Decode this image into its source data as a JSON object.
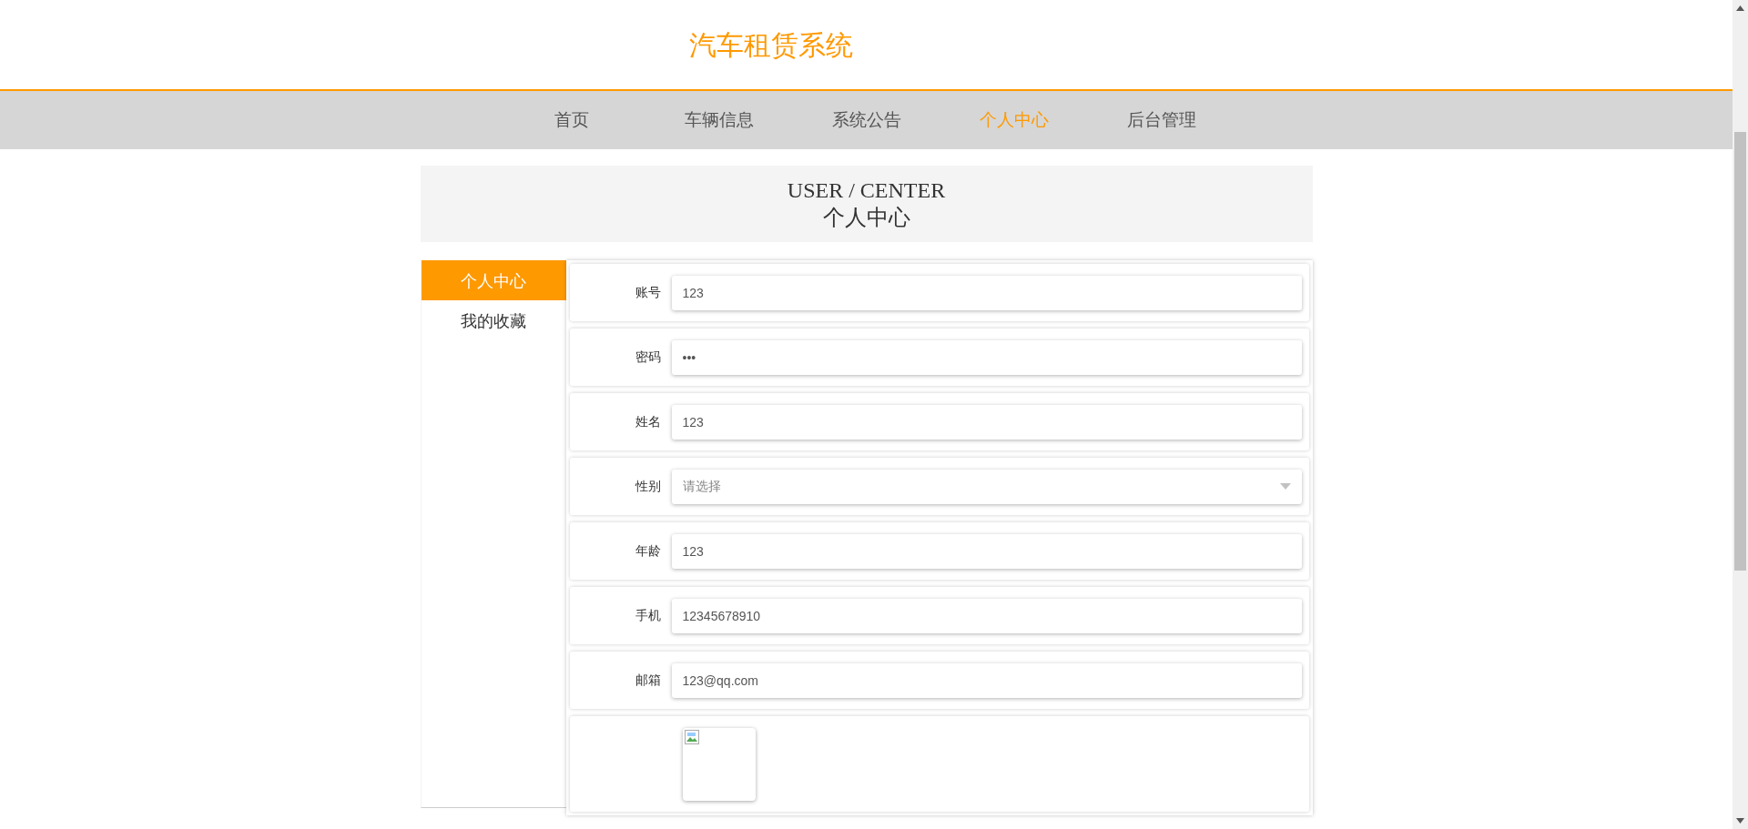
{
  "header": {
    "title": "汽车租赁系统"
  },
  "nav": [
    {
      "label": "首页",
      "selected": false
    },
    {
      "label": "车辆信息",
      "selected": false
    },
    {
      "label": "系统公告",
      "selected": false
    },
    {
      "label": "个人中心",
      "selected": true
    },
    {
      "label": "后台管理",
      "selected": false
    }
  ],
  "banner": {
    "title": "USER / CENTER",
    "subtitle": "个人中心"
  },
  "sidebar": {
    "items": [
      {
        "label": "个人中心",
        "selected": true
      },
      {
        "label": "我的收藏",
        "selected": false
      }
    ]
  },
  "form": {
    "fields": [
      {
        "kind": "text",
        "label": "账号",
        "value": "123"
      },
      {
        "kind": "password",
        "label": "密码",
        "value": "•••"
      },
      {
        "kind": "text",
        "label": "姓名",
        "value": "123"
      },
      {
        "kind": "select",
        "label": "性别",
        "placeholder": "请选择"
      },
      {
        "kind": "text",
        "label": "年龄",
        "value": "123"
      },
      {
        "kind": "text",
        "label": "手机",
        "value": "12345678910"
      },
      {
        "kind": "text",
        "label": "邮箱",
        "value": "123@qq.com"
      },
      {
        "kind": "image"
      }
    ]
  }
}
